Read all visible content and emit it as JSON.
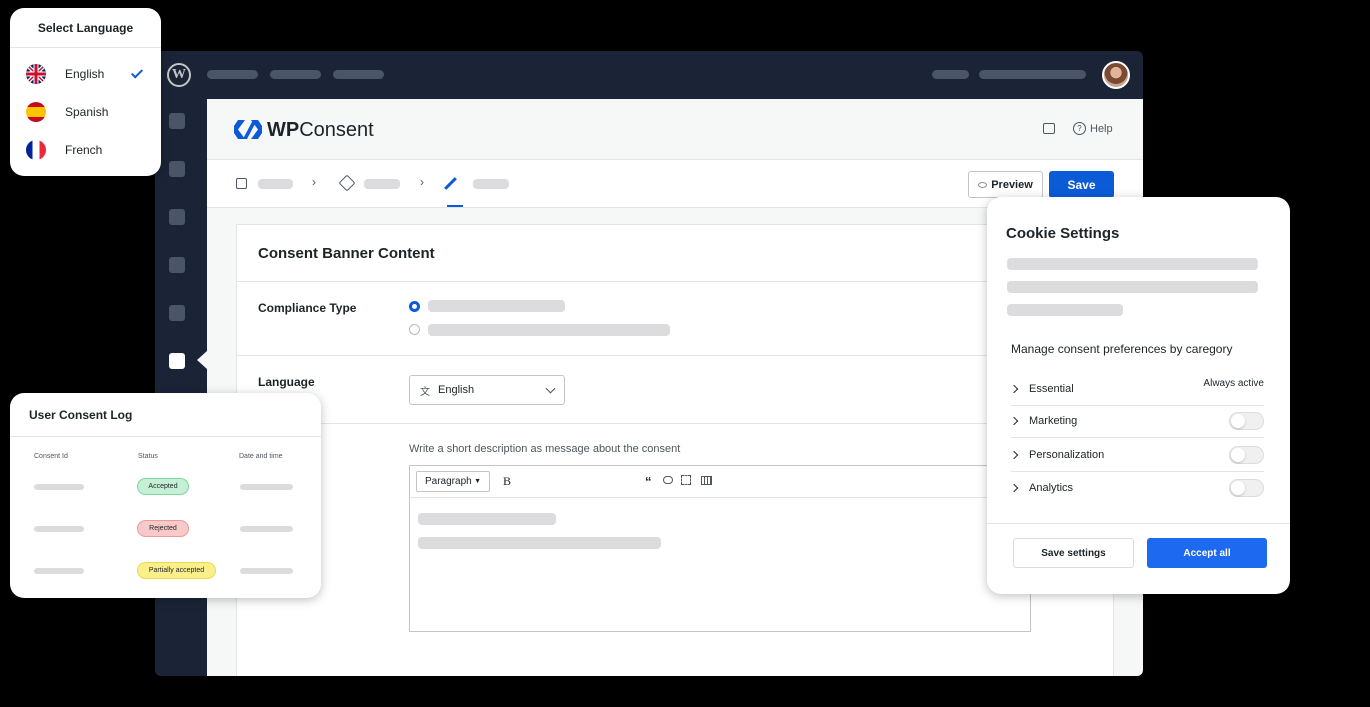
{
  "language_card": {
    "title": "Select Language",
    "items": [
      {
        "label": "English",
        "flag": "uk-flag-icon",
        "selected": true
      },
      {
        "label": "Spanish",
        "flag": "spain-flag-icon",
        "selected": false
      },
      {
        "label": "French",
        "flag": "france-flag-icon",
        "selected": false
      }
    ]
  },
  "wp": {
    "brand": "WPConsent",
    "brand_prefix": "WP",
    "brand_suffix": "Consent",
    "help_label": "Help",
    "preview_label": "Preview",
    "save_label": "Save",
    "accent": "#0b5bd7"
  },
  "banner": {
    "title": "Consent Banner Content",
    "compliance_label": "Compliance Type",
    "language_label": "Language",
    "language_value": "English",
    "description_prompt": "Write a short description as message about the consent",
    "paragraph_label": "Paragraph",
    "bold_label": "B"
  },
  "log_card": {
    "title": "User Consent Log",
    "columns": [
      "Consent Id",
      "Status",
      "Date and time"
    ],
    "rows": [
      {
        "status": "Accepted",
        "color": "#c6f0d6"
      },
      {
        "status": "Rejected",
        "color": "#f8c9c9"
      },
      {
        "status": "Partially accepted",
        "color": "#fbef8c"
      }
    ]
  },
  "cookie_card": {
    "title": "Cookie Settings",
    "subtitle": "Manage consent preferences by caregory",
    "categories": [
      {
        "label": "Essential",
        "state": "Always active"
      },
      {
        "label": "Marketing",
        "state": "off"
      },
      {
        "label": "Personalization",
        "state": "off"
      },
      {
        "label": "Analytics",
        "state": "off"
      }
    ],
    "save_settings": "Save settings",
    "accept_all": "Accept all"
  }
}
